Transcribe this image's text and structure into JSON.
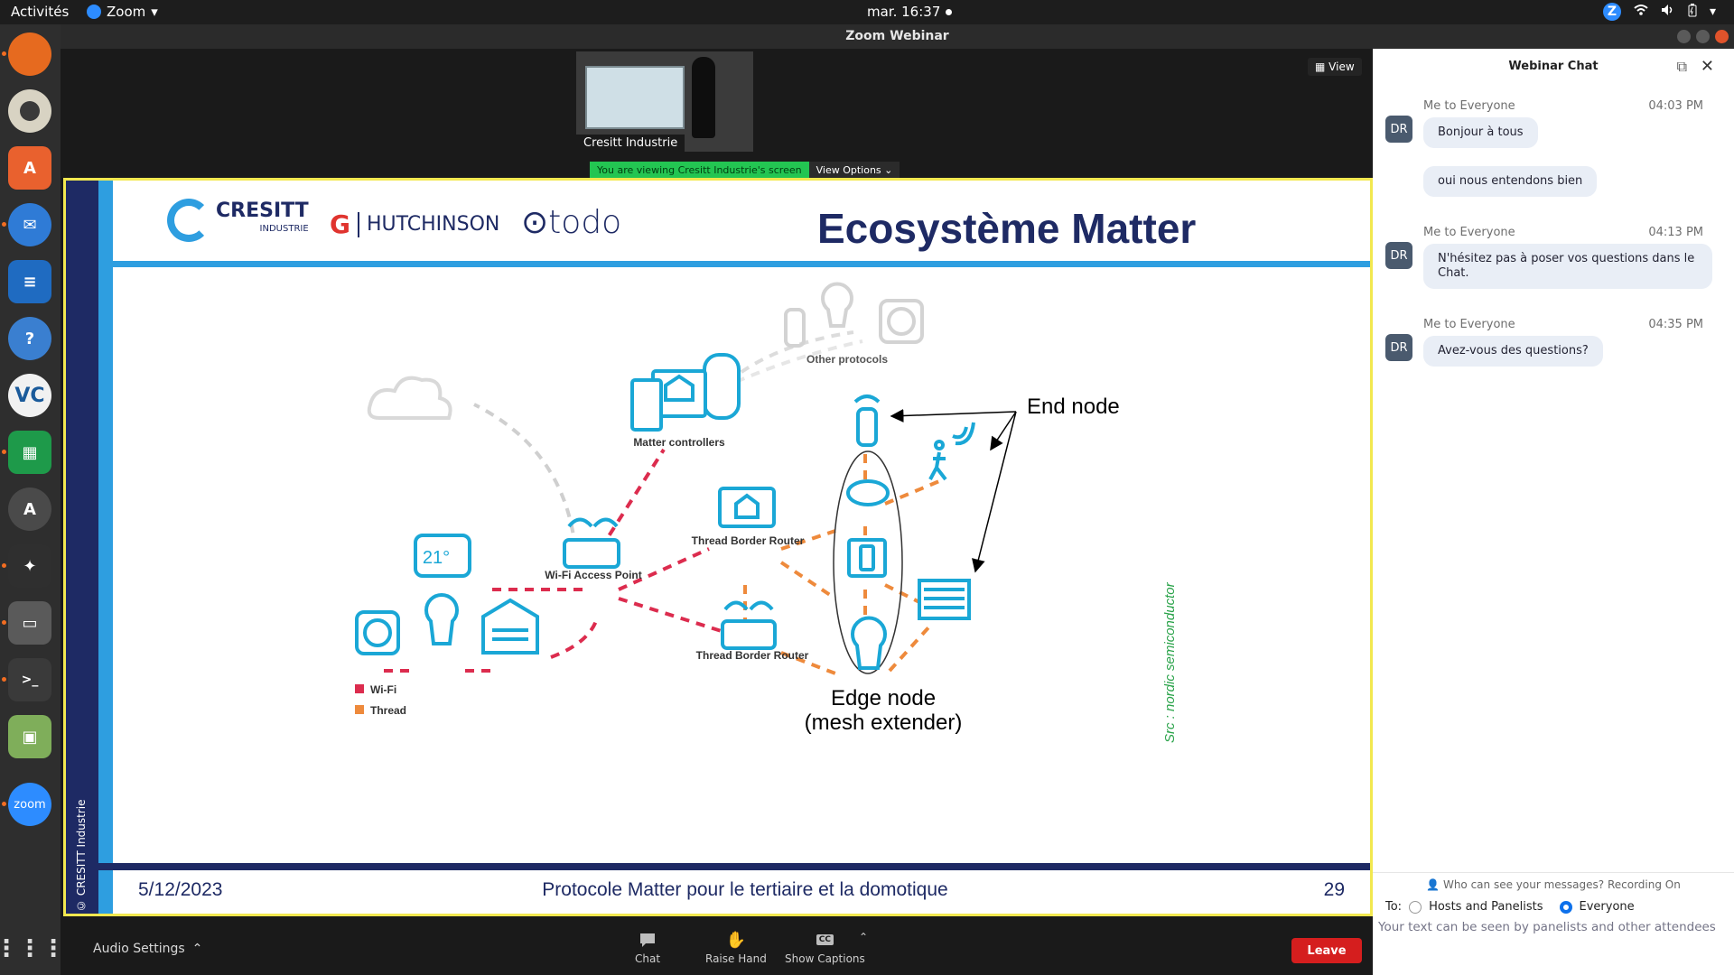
{
  "topbar": {
    "activities": "Activités",
    "app": "Zoom",
    "clock": "mar. 16:37"
  },
  "window": {
    "title": "Zoom Webinar"
  },
  "video": {
    "name": "Cresitt Industrie",
    "view_label": "View"
  },
  "share_bar": {
    "message": "You are viewing Cresitt Industrie's screen",
    "options": "View Options"
  },
  "slide": {
    "title": "Ecosystème Matter",
    "copyright": "© CRESITT Industrie",
    "logos": {
      "cresitt": "CRESITT",
      "cresitt_sub": "INDUSTRIE",
      "hutchinson": "HUTCHINSON",
      "todo": "todo"
    },
    "source": "Src : nordic semiconductor",
    "labels": {
      "other_protocols": "Other protocols",
      "matter_controllers": "Matter controllers",
      "wifi_ap": "Wi-Fi Access Point",
      "tbr1": "Thread Border Router",
      "tbr2": "Thread Border Router",
      "end_node": "End node",
      "edge_node_1": "Edge node",
      "edge_node_2": "(mesh extender)",
      "thermo": "21°",
      "legend_wifi": "Wi-Fi",
      "legend_thread": "Thread"
    },
    "footer": {
      "date": "5/12/2023",
      "topic": "Protocole Matter pour le tertiaire et la domotique",
      "page": "29"
    },
    "colors": {
      "navy": "#1e2a64",
      "blue": "#2e9ee0",
      "device": "#1aa7d6",
      "wifi": "#dc2c4e",
      "thread": "#ee8a3c"
    }
  },
  "toolbar": {
    "audio": "Audio Settings",
    "chat": "Chat",
    "raise_hand": "Raise Hand",
    "captions": "Show Captions",
    "leave": "Leave"
  },
  "chat": {
    "title": "Webinar Chat",
    "messages": [
      {
        "from": "Me to Everyone",
        "time": "04:03 PM",
        "avatar": "DR",
        "texts": [
          "Bonjour à tous",
          "oui nous entendons bien"
        ]
      },
      {
        "from": "Me to Everyone",
        "time": "04:13 PM",
        "avatar": "DR",
        "texts": [
          "N'hésitez pas à poser vos questions dans le Chat."
        ]
      },
      {
        "from": "Me to Everyone",
        "time": "04:35 PM",
        "avatar": "DR",
        "texts": [
          "Avez-vous des questions?"
        ]
      }
    ],
    "who_can_see": "Who can see your messages? Recording On",
    "to_label": "To:",
    "to_options": [
      "Hosts and Panelists",
      "Everyone"
    ],
    "to_selected": "Everyone",
    "hint": "Your text can be seen by panelists and other attendees"
  }
}
